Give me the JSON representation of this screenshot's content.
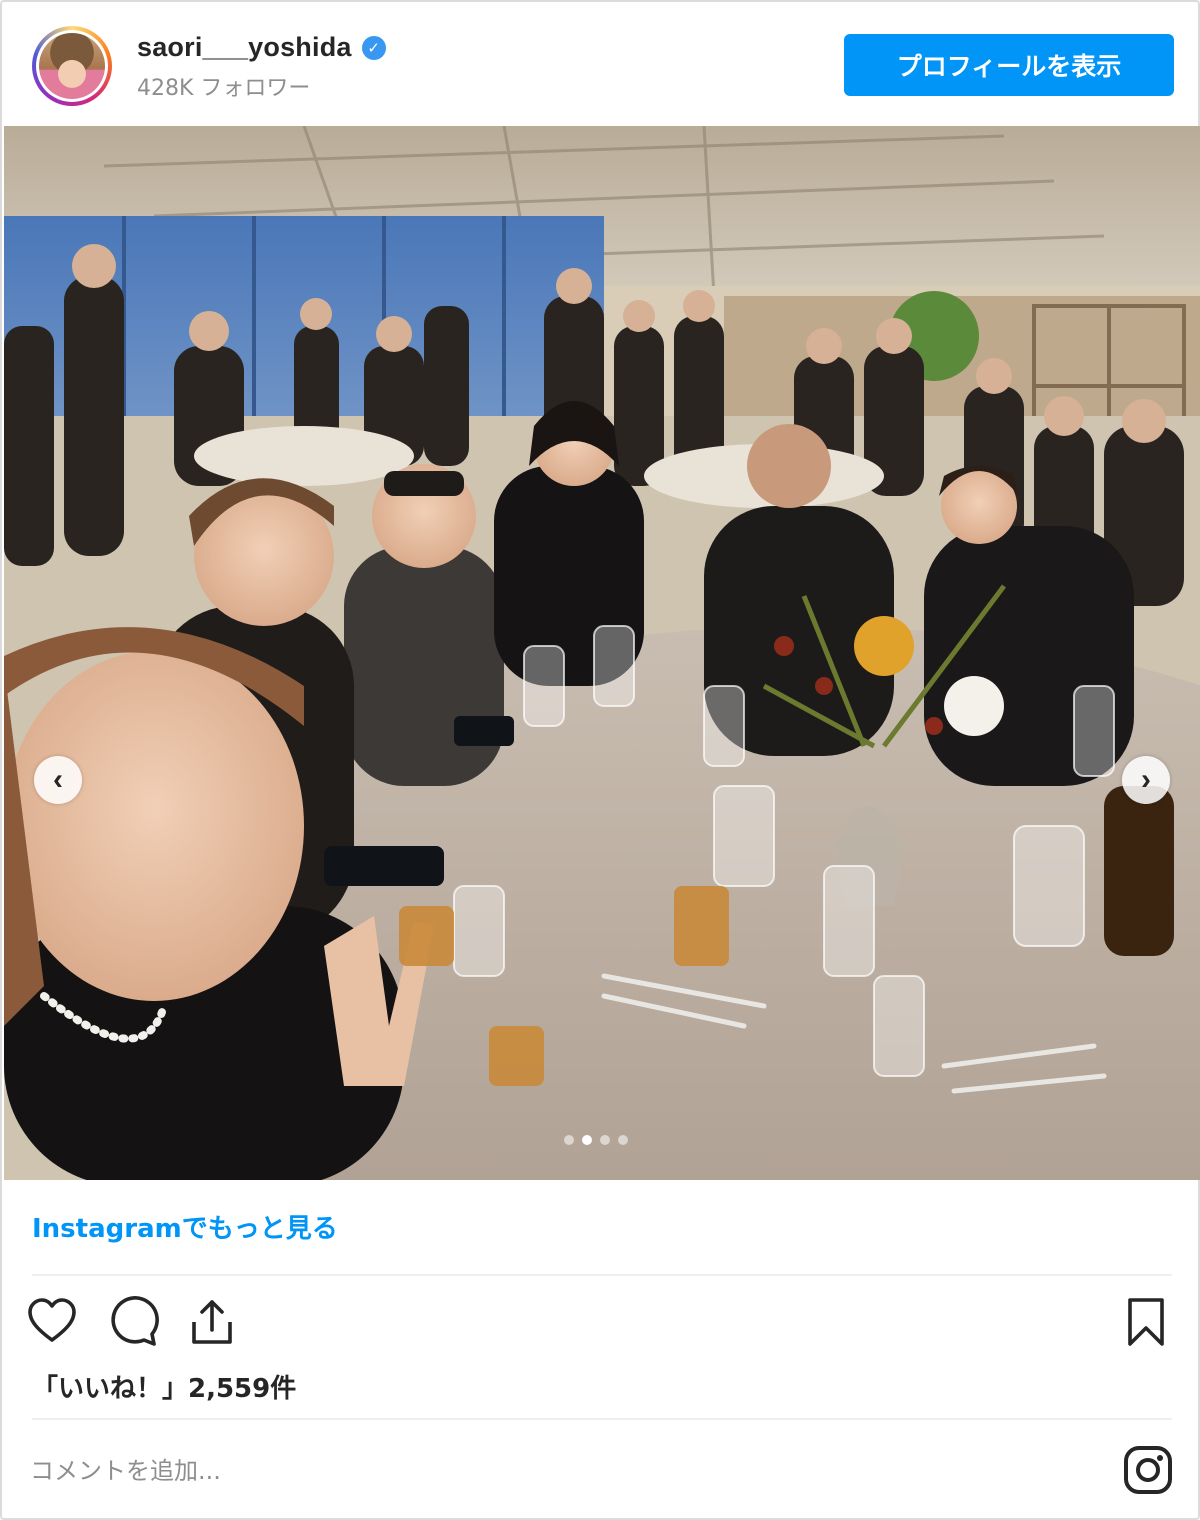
{
  "header": {
    "username": "saori___yoshida",
    "verified_mark": "✓",
    "followers": "428K フォロワー",
    "profile_button": "プロフィールを表示"
  },
  "post": {
    "image_label": "",
    "prev_icon": "chevron-left-icon",
    "next_icon": "chevron-right-icon",
    "prev_glyph": "‹",
    "next_glyph": "›",
    "carousel_count": 4,
    "carousel_active_index": 1
  },
  "more_link": "Instagramでもっと見る",
  "actions": {
    "icons": [
      "heart-icon",
      "comment-icon",
      "share-icon",
      "bookmark-icon"
    ]
  },
  "likes": "「いいね！」2,559件",
  "comment": {
    "placeholder": "コメントを追加..."
  },
  "colors": {
    "accent": "#0095f6",
    "text": "#262626",
    "muted": "#8e8e8e",
    "border": "#dbdbdb"
  }
}
